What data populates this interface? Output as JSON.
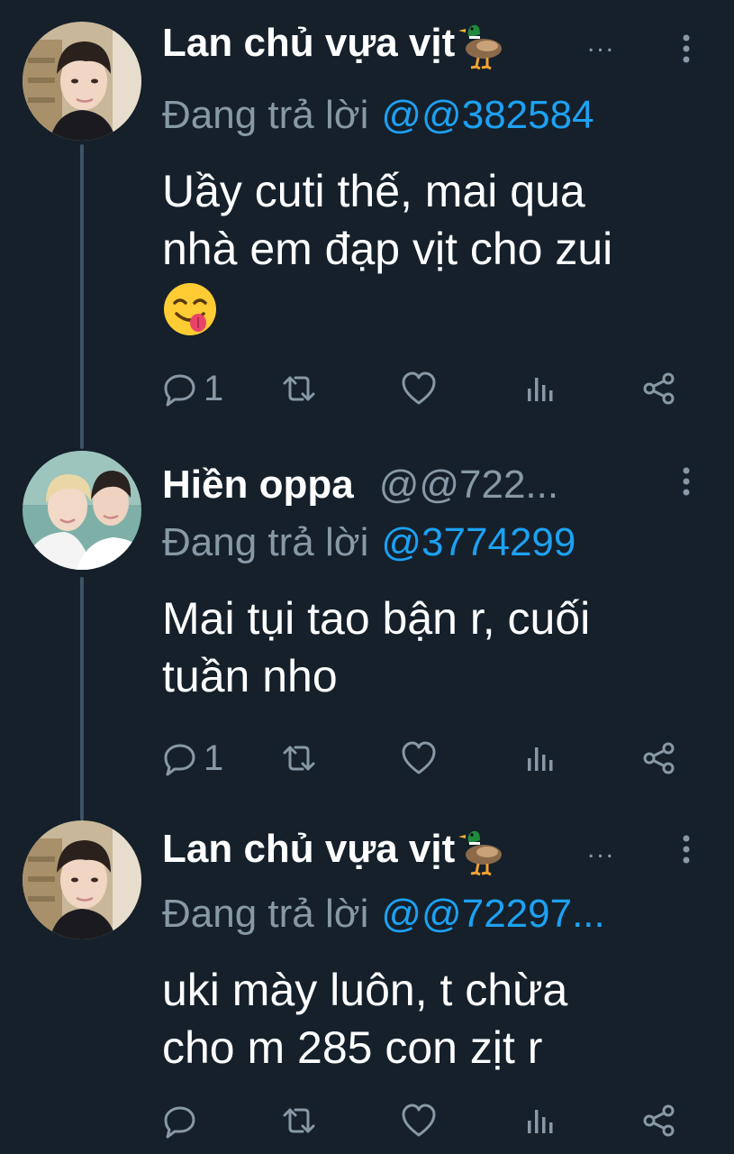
{
  "colors": {
    "background": "#15202b",
    "text": "#ffffff",
    "secondary": "#8899a6",
    "accent": "#1da1f2",
    "thread_line": "#3d5466"
  },
  "tweets": [
    {
      "display_name": "Lan chủ vựa vịt",
      "name_emoji": "duck",
      "handle": "",
      "ellipsis": "...",
      "reply_prefix": "Đang trả lời",
      "reply_to": "@@382584",
      "text_lines": [
        "Uầy cuti thế, mai qua",
        "nhà em đạp vịt cho zui"
      ],
      "text_emoji": "face-savoring-food",
      "reply_count": "1",
      "avatar": "avatar-photo-boy"
    },
    {
      "display_name": "Hiền oppa",
      "name_emoji": "",
      "handle": "@@722...",
      "ellipsis": "",
      "reply_prefix": "Đang trả lời",
      "reply_to": "@3774299",
      "text_lines": [
        "Mai tụi tao bận r, cuối",
        "tuần nho"
      ],
      "text_emoji": "",
      "reply_count": "1",
      "avatar": "avatar-photo-couple"
    },
    {
      "display_name": "Lan chủ vựa vịt",
      "name_emoji": "duck",
      "handle": "",
      "ellipsis": "...",
      "reply_prefix": "Đang trả lời",
      "reply_to": "@@72297...",
      "text_lines": [
        "uki mày luôn, t chừa",
        "cho m 285 con zịt r"
      ],
      "text_emoji": "",
      "reply_count": "",
      "avatar": "avatar-photo-boy"
    }
  ],
  "icons": {
    "reply": "reply-icon",
    "retweet": "retweet-icon",
    "like": "heart-icon",
    "analytics": "analytics-icon",
    "share": "share-icon",
    "more": "more-vertical-icon"
  }
}
